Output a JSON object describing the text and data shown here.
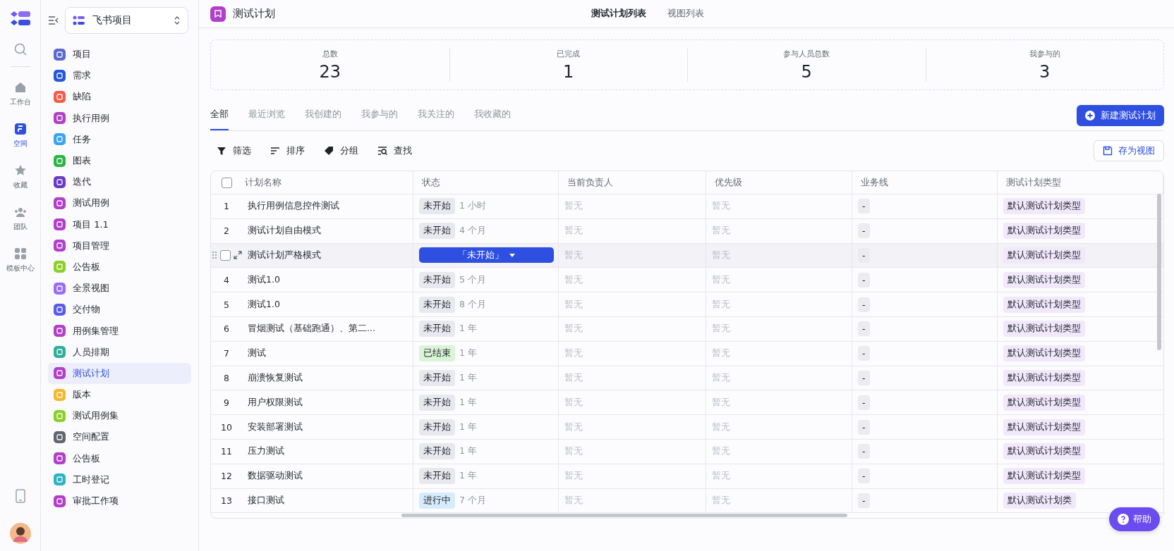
{
  "rail": {
    "items": [
      {
        "label": "工作台",
        "selected": false,
        "kind": "home"
      },
      {
        "label": "空间",
        "selected": true,
        "kind": "space"
      },
      {
        "label": "收藏",
        "selected": false,
        "kind": "star"
      },
      {
        "label": "团队",
        "selected": false,
        "kind": "team"
      },
      {
        "label": "模板中心",
        "selected": false,
        "kind": "grid"
      }
    ]
  },
  "sidebar": {
    "workspace": "飞书项目",
    "items": [
      {
        "label": "项目",
        "color": "#5b6bc9",
        "selected": false
      },
      {
        "label": "需求",
        "color": "#2458d8",
        "selected": false
      },
      {
        "label": "缺陷",
        "color": "#f25c48",
        "selected": false
      },
      {
        "label": "执行用例",
        "color": "#b040c8",
        "selected": false
      },
      {
        "label": "任务",
        "color": "#3ba4f0",
        "selected": false
      },
      {
        "label": "图表",
        "color": "#2fb344",
        "selected": false
      },
      {
        "label": "迭代",
        "color": "#6a3bc4",
        "selected": false
      },
      {
        "label": "测试用例",
        "color": "#b040c8",
        "selected": false
      },
      {
        "label": "项目 1.1",
        "color": "#b040c8",
        "selected": false
      },
      {
        "label": "项目管理",
        "color": "#b040c8",
        "selected": false
      },
      {
        "label": "公告板",
        "color": "#8ccf2a",
        "selected": false
      },
      {
        "label": "全景视图",
        "color": "#9a6cf0",
        "selected": false
      },
      {
        "label": "交付物",
        "color": "#5a5ce8",
        "selected": false
      },
      {
        "label": "用例集管理",
        "color": "#b040c8",
        "selected": false
      },
      {
        "label": "人员排期",
        "color": "#2fae9a",
        "selected": false
      },
      {
        "label": "测试计划",
        "color": "#b040c8",
        "selected": true
      },
      {
        "label": "版本",
        "color": "#f5b72f",
        "selected": false
      },
      {
        "label": "测试用例集",
        "color": "#8ccf2a",
        "selected": false
      },
      {
        "label": "空间配置",
        "color": "#5f6670",
        "selected": false
      },
      {
        "label": "公告板",
        "color": "#b040c8",
        "selected": false
      },
      {
        "label": "工时登记",
        "color": "#2fb2c2",
        "selected": false
      },
      {
        "label": "审批工作项",
        "color": "#b040c8",
        "selected": false
      }
    ]
  },
  "header": {
    "title": "测试计划",
    "tabs": [
      {
        "label": "测试计划列表",
        "selected": true
      },
      {
        "label": "视图列表",
        "selected": false
      }
    ]
  },
  "stats": [
    {
      "label": "总数",
      "value": "23"
    },
    {
      "label": "已完成",
      "value": "1"
    },
    {
      "label": "参与人员总数",
      "value": "5"
    },
    {
      "label": "我参与的",
      "value": "3"
    }
  ],
  "filter_tabs": [
    {
      "label": "全部",
      "selected": true
    },
    {
      "label": "最近浏览",
      "selected": false
    },
    {
      "label": "我创建的",
      "selected": false
    },
    {
      "label": "我参与的",
      "selected": false
    },
    {
      "label": "我关注的",
      "selected": false
    },
    {
      "label": "我收藏的",
      "selected": false
    }
  ],
  "new_button": "新建测试计划",
  "toolbar": [
    {
      "label": "筛选",
      "kind": "filter"
    },
    {
      "label": "排序",
      "kind": "sort"
    },
    {
      "label": "分组",
      "kind": "tag"
    },
    {
      "label": "查找",
      "kind": "find"
    }
  ],
  "save_view_button": "存为视图",
  "table": {
    "columns": [
      "计划名称",
      "状态",
      "当前负责人",
      "优先级",
      "业务线",
      "测试计划类型"
    ],
    "select_all_checked": false,
    "rows": [
      {
        "index": "1",
        "name": "执行用例信息控件测试",
        "status": "未开始",
        "color": "#e8e9ee",
        "time": "1 小时",
        "owner": "暂无",
        "priority": "暂无",
        "business": "-",
        "type": "默认测试计划类型",
        "hovered": false
      },
      {
        "index": "2",
        "name": "测试计划自由模式",
        "status": "未开始",
        "color": "#e8e9ee",
        "time": "4 个月",
        "owner": "暂无",
        "priority": "暂无",
        "business": "-",
        "type": "默认测试计划类型",
        "hovered": false
      },
      {
        "name": "测试计划严格模式",
        "status_select": "「未开始」",
        "owner": "暂无",
        "priority": "暂无",
        "business": "-",
        "type": "默认测试计划类型",
        "hovered": true
      },
      {
        "index": "4",
        "name": "测试1.0",
        "status": "未开始",
        "color": "#e8e9ee",
        "time": "5 个月",
        "owner": "暂无",
        "priority": "暂无",
        "business": "-",
        "type": "默认测试计划类型",
        "hovered": false
      },
      {
        "index": "5",
        "name": "测试1.0",
        "status": "未开始",
        "color": "#e8e9ee",
        "time": "8 个月",
        "owner": "暂无",
        "priority": "暂无",
        "business": "-",
        "type": "默认测试计划类型",
        "hovered": false
      },
      {
        "index": "6",
        "name": "冒烟测试（基础跑通）、第二...",
        "status": "未开始",
        "color": "#e8e9ee",
        "time": "1 年",
        "owner": "暂无",
        "priority": "暂无",
        "business": "-",
        "type": "默认测试计划类型",
        "hovered": false
      },
      {
        "index": "7",
        "name": "测试",
        "status": "已结束",
        "color": "#d9f5d6",
        "time": "1 年",
        "owner": "暂无",
        "priority": "暂无",
        "business": "-",
        "type": "默认测试计划类型",
        "hovered": false
      },
      {
        "index": "8",
        "name": "崩溃恢复测试",
        "status": "未开始",
        "color": "#e8e9ee",
        "time": "1 年",
        "owner": "暂无",
        "priority": "暂无",
        "business": "-",
        "type": "默认测试计划类型",
        "hovered": false
      },
      {
        "index": "9",
        "name": "用户权限测试",
        "status": "未开始",
        "color": "#e8e9ee",
        "time": "1 年",
        "owner": "暂无",
        "priority": "暂无",
        "business": "-",
        "type": "默认测试计划类型",
        "hovered": false
      },
      {
        "index": "10",
        "name": "安装部署测试",
        "status": "未开始",
        "color": "#e8e9ee",
        "time": "1 年",
        "owner": "暂无",
        "priority": "暂无",
        "business": "-",
        "type": "默认测试计划类型",
        "hovered": false
      },
      {
        "index": "11",
        "name": "压力测试",
        "status": "未开始",
        "color": "#e8e9ee",
        "time": "1 年",
        "owner": "暂无",
        "priority": "暂无",
        "business": "-",
        "type": "默认测试计划类型",
        "hovered": false
      },
      {
        "index": "12",
        "name": "数据驱动测试",
        "status": "未开始",
        "color": "#e8e9ee",
        "time": "1 年",
        "owner": "暂无",
        "priority": "暂无",
        "business": "-",
        "type": "默认测试计划类型",
        "hovered": false
      },
      {
        "index": "13",
        "name": "接口测试",
        "status": "进行中",
        "color": "#d6ecfc",
        "time": "7 个月",
        "owner": "暂无",
        "priority": "暂无",
        "business": "-",
        "type": "默认测试计划类",
        "hovered": false
      }
    ]
  },
  "help_button": "帮助"
}
